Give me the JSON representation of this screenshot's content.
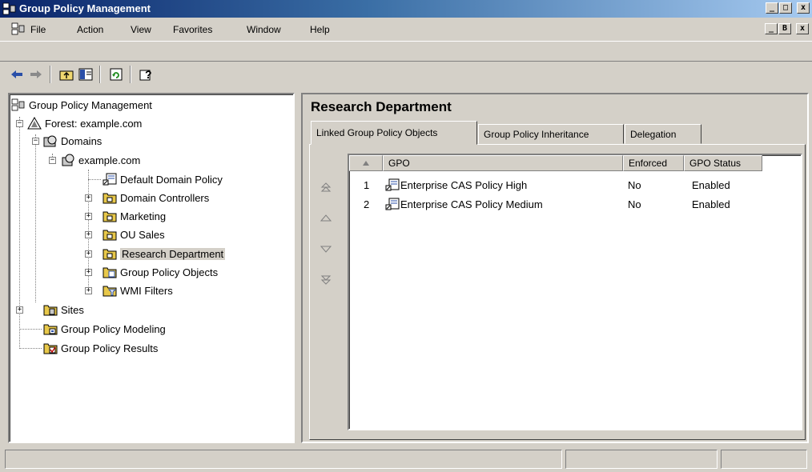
{
  "window": {
    "title": "Group Policy Management",
    "buttons": {
      "minimize": "_",
      "maximize": "□",
      "close": "x"
    }
  },
  "menu": {
    "items": [
      "File",
      "Action",
      "View",
      "Favorites",
      "Window",
      "Help"
    ],
    "mdi_buttons": {
      "minimize": "_",
      "restore": "B",
      "close": "x"
    }
  },
  "toolbar": {
    "icons": [
      "back-icon",
      "forward-icon",
      "up-level-icon",
      "show-hide-tree-icon",
      "refresh-icon",
      "help-icon"
    ]
  },
  "tree": {
    "items": [
      {
        "label": "Group Policy Management"
      },
      {
        "label": "Forest: example.com"
      },
      {
        "label": "Domains"
      },
      {
        "label": "example.com"
      },
      {
        "label": "Default Domain Policy"
      },
      {
        "label": "Domain Controllers"
      },
      {
        "label": "Marketing"
      },
      {
        "label": "OU Sales"
      },
      {
        "label": "Research Department"
      },
      {
        "label": "Group Policy Objects"
      },
      {
        "label": "WMI Filters"
      },
      {
        "label": "Sites"
      },
      {
        "label": "Group Policy Modeling"
      },
      {
        "label": "Group Policy Results"
      }
    ],
    "selected": "Research Department"
  },
  "details": {
    "title": "Research Department",
    "tabs": [
      {
        "label": "Linked Group Policy Objects"
      },
      {
        "label": "Group Policy Inheritance"
      },
      {
        "label": "Delegation"
      }
    ],
    "table": {
      "columns": [
        "",
        "GPO",
        "Enforced",
        "GPO Status"
      ],
      "rows": [
        {
          "order": "1",
          "gpo": "Enterprise CAS Policy High",
          "enforced": "No",
          "status": "Enabled"
        },
        {
          "order": "2",
          "gpo": "Enterprise CAS Policy Medium",
          "enforced": "No",
          "status": "Enabled"
        }
      ]
    }
  },
  "colors": {
    "title_start": "#0a246a",
    "title_end": "#a6caf0",
    "face": "#d4d0c8",
    "folder": "#e8c84a"
  }
}
